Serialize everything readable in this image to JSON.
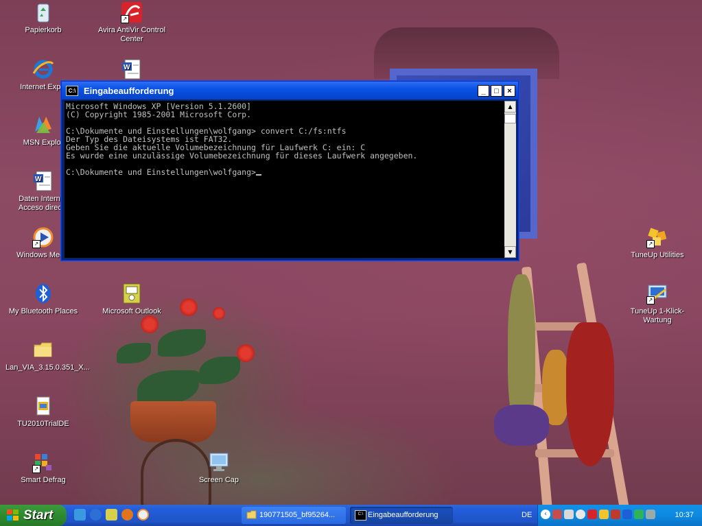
{
  "desktop": {
    "icons": [
      {
        "label": "Papierkorb",
        "icon": "recycle-bin-icon"
      },
      {
        "label": "Avira AntiVir Control Center",
        "icon": "avira-icon"
      },
      {
        "label": "Internet Explo",
        "icon": "internet-explorer-icon"
      },
      {
        "label": "",
        "icon": "word-document-icon"
      },
      {
        "label": "MSN Explor",
        "icon": "msn-icon"
      },
      {
        "label": "Daten Intern w Acceso directo",
        "icon": "word-document-icon"
      },
      {
        "label": "Windows Media",
        "icon": "windows-media-icon"
      },
      {
        "label": "My Bluetooth Places",
        "icon": "bluetooth-icon"
      },
      {
        "label": "Microsoft Outlook",
        "icon": "outlook-icon"
      },
      {
        "label": "Lan_VIA_3.15.0.351_X...",
        "icon": "folder-icon"
      },
      {
        "label": "TU2010TrialDE",
        "icon": "installer-icon"
      },
      {
        "label": "Smart Defrag",
        "icon": "defrag-icon"
      },
      {
        "label": "Screen Cap",
        "icon": "monitor-icon"
      },
      {
        "label": "TuneUp Utilities",
        "icon": "tuneup-icon"
      },
      {
        "label": "TuneUp 1-Klick-Wartung",
        "icon": "tuneup-wartung-icon"
      }
    ]
  },
  "console": {
    "title": "Eingabeaufforderung",
    "lines": [
      "Microsoft Windows XP [Version 5.1.2600]",
      "(C) Copyright 1985-2001 Microsoft Corp.",
      "",
      "C:\\Dokumente und Einstellungen\\wolfgang> convert C:/fs:ntfs",
      "Der Typ des Dateisystems ist FAT32.",
      "Geben Sie die aktuelle Volumebezeichnung für Laufwerk C: ein: C",
      "Es wurde eine unzulässige Volumebezeichnung für dieses Laufwerk angegeben.",
      "",
      "C:\\Dokumente und Einstellungen\\wolfgang>"
    ],
    "buttons": {
      "minimize": "_",
      "maximize": "□",
      "close": "×"
    }
  },
  "taskbar": {
    "start_label": "Start",
    "tasks": [
      {
        "label": "190771505_bf95264...",
        "icon": "folder-icon"
      },
      {
        "label": "Eingabeaufforderung",
        "icon": "console-icon"
      }
    ],
    "language": "DE",
    "clock": "10:37"
  }
}
